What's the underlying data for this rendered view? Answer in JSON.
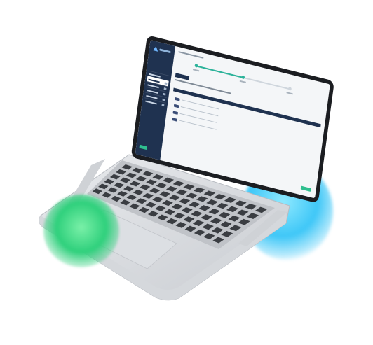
{
  "image": {
    "subject": "laptop-mockup",
    "accent_colors": {
      "teal": "#2bb39a",
      "navy": "#1f3250",
      "glow_blue": "#3fc7f7",
      "glow_green": "#2fd07c"
    },
    "screen_steps": {
      "completed": 2,
      "total": 3,
      "progress": 0.5
    }
  }
}
